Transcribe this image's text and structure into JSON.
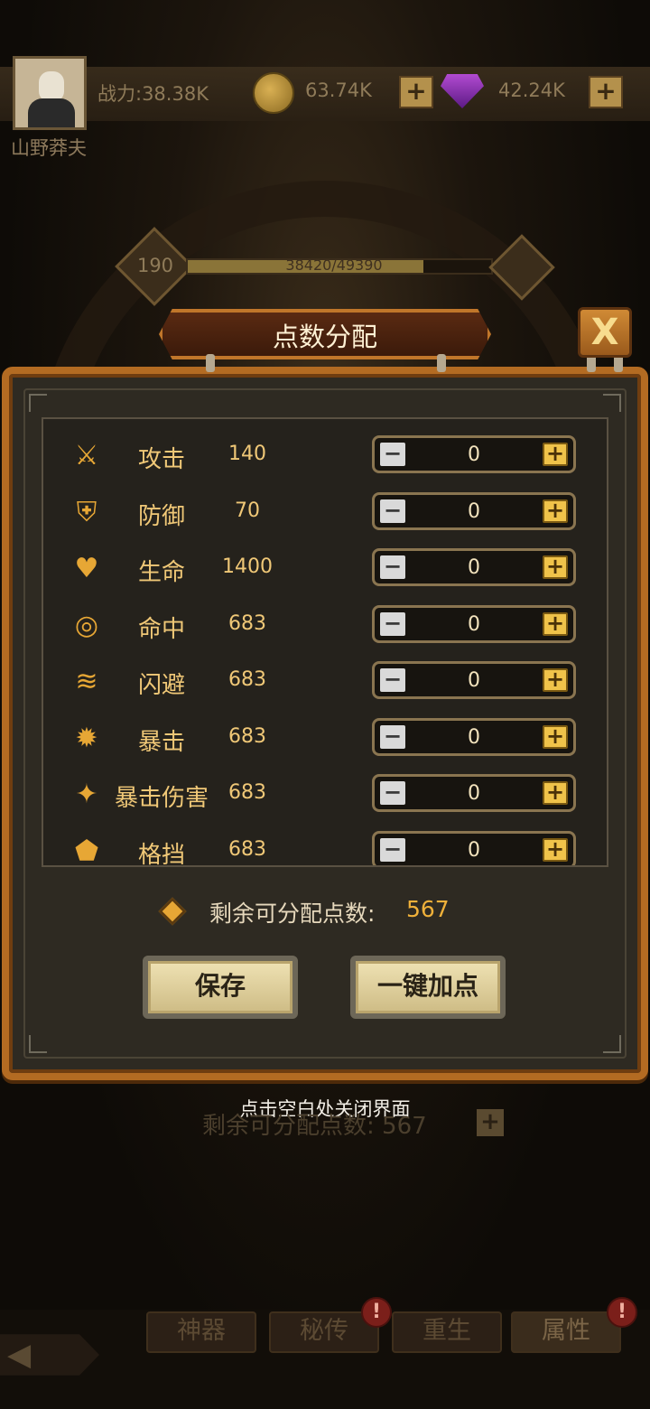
{
  "header": {
    "player_name": "山野莽夫",
    "power_text": "战力:38.38K",
    "gold": "63.74K",
    "gems": "42.24K",
    "plus": "+"
  },
  "level": {
    "value": "190",
    "exp_text": "38420/49390",
    "exp_fraction": 0.778
  },
  "dialog": {
    "title": "点数分配",
    "close_glyph": "X",
    "stats": [
      {
        "label": "攻击",
        "value": "140",
        "alloc": "0",
        "icon": "sword-icon"
      },
      {
        "label": "防御",
        "value": "70",
        "alloc": "0",
        "icon": "shield-icon"
      },
      {
        "label": "生命",
        "value": "1400",
        "alloc": "0",
        "icon": "heart-icon"
      },
      {
        "label": "命中",
        "value": "683",
        "alloc": "0",
        "icon": "target-icon"
      },
      {
        "label": "闪避",
        "value": "683",
        "alloc": "0",
        "icon": "dodge-icon"
      },
      {
        "label": "暴击",
        "value": "683",
        "alloc": "0",
        "icon": "crit-icon"
      },
      {
        "label": "暴击伤害",
        "value": "683",
        "alloc": "0",
        "icon": "crit-damage-icon"
      },
      {
        "label": "格挡",
        "value": "683",
        "alloc": "0",
        "icon": "block-icon"
      }
    ],
    "minus_glyph": "−",
    "plus_glyph": "+",
    "remaining_label": "剩余可分配点数:",
    "remaining_value": "567",
    "save_label": "保存",
    "auto_label": "一键加点"
  },
  "hint": "点击空白处关闭界面",
  "background": {
    "remaining_label": "剩余可分配点数:",
    "remaining_value": "567"
  },
  "tabs": [
    {
      "label": "神器",
      "alert": false
    },
    {
      "label": "秘传",
      "alert": true
    },
    {
      "label": "重生",
      "alert": false
    },
    {
      "label": "属性",
      "alert": true
    }
  ],
  "alert_glyph": "!",
  "colors": {
    "accent": "#e7a735",
    "frame": "#b36b22",
    "remaining": "#f0b13a"
  }
}
